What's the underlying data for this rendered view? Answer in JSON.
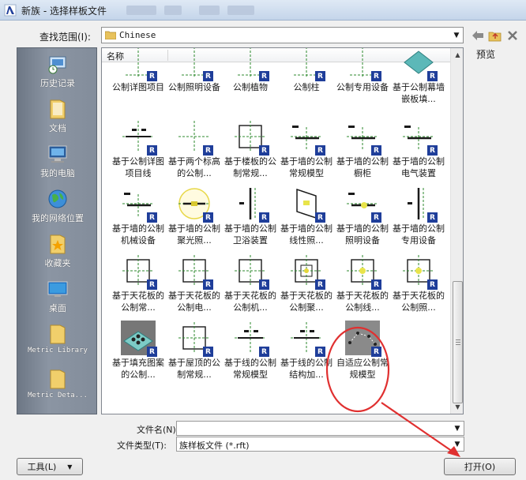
{
  "window": {
    "title": "新族 - 选择样板文件"
  },
  "look_in": {
    "label": "查找范围(I):",
    "value": "Chinese"
  },
  "places": [
    {
      "label": "历史记录",
      "icon": "history-icon"
    },
    {
      "label": "文档",
      "icon": "folder-icon"
    },
    {
      "label": "我的电脑",
      "icon": "computer-icon"
    },
    {
      "label": "我的网络位置",
      "icon": "network-globe-icon"
    },
    {
      "label": "收藏夹",
      "icon": "favorites-folder-icon"
    },
    {
      "label": "桌面",
      "icon": "desktop-icon"
    },
    {
      "label": "Metric Library",
      "icon": "folder-icon"
    },
    {
      "label": "Metric Deta...",
      "icon": "folder-icon"
    }
  ],
  "list": {
    "column_name": "名称",
    "rows": [
      [
        {
          "label": "公制详图项目",
          "icon": "dash-line-template-icon"
        },
        {
          "label": "公制照明设备",
          "icon": "dash-line-template-icon"
        },
        {
          "label": "公制植物",
          "icon": "dash-line-template-icon"
        },
        {
          "label": "公制柱",
          "icon": "dash-line-template-icon"
        },
        {
          "label": "公制专用设备",
          "icon": "dash-line-template-icon"
        },
        {
          "label": "基于公制幕墙嵌板填...",
          "icon": "panel-3d-icon"
        }
      ],
      [
        {
          "label": "基于公制详图项目线",
          "icon": "cross-line-template-icon"
        },
        {
          "label": "基于两个标高的公制...",
          "icon": "cross-template-icon"
        },
        {
          "label": "基于楼板的公制常规...",
          "icon": "box-cross-template-icon"
        },
        {
          "label": "基于墙的公制常规模型",
          "icon": "wall-line-template-icon"
        },
        {
          "label": "基于墙的公制橱柜",
          "icon": "wall-line-template-icon"
        },
        {
          "label": "基于墙的公制电气装置",
          "icon": "wall-line-template-icon"
        }
      ],
      [
        {
          "label": "基于墙的公制机械设备",
          "icon": "wall-line-template-icon"
        },
        {
          "label": "基于墙的公制聚光照...",
          "icon": "spotlight-template-icon"
        },
        {
          "label": "基于墙的公制卫浴装置",
          "icon": "vertical-line-template-icon"
        },
        {
          "label": "基于墙的公制线性照...",
          "icon": "linear-light-template-icon"
        },
        {
          "label": "基于墙的公制照明设备",
          "icon": "wall-light-template-icon"
        },
        {
          "label": "基于墙的公制专用设备",
          "icon": "vertical-line-template-icon"
        }
      ],
      [
        {
          "label": "基于天花板的公制常...",
          "icon": "box-cross-template-icon"
        },
        {
          "label": "基于天花板的公制电...",
          "icon": "box-cross-template-icon"
        },
        {
          "label": "基于天花板的公制机...",
          "icon": "box-cross-template-icon"
        },
        {
          "label": "基于天花板的公制聚...",
          "icon": "box-dot-template-icon"
        },
        {
          "label": "基于天花板的公制线...",
          "icon": "box-light-template-icon"
        },
        {
          "label": "基于天花板的公制照...",
          "icon": "box-light-template-icon"
        }
      ],
      [
        {
          "label": "基于填充图案的公制...",
          "icon": "pattern-3d-icon"
        },
        {
          "label": "基于屋顶的公制常规...",
          "icon": "box-cross-template-icon"
        },
        {
          "label": "基于线的公制常规模型",
          "icon": "cross-line-template-icon"
        },
        {
          "label": "基于线的公制结构加...",
          "icon": "cross-line-template-icon"
        },
        {
          "label": "自适应公制常规模型",
          "icon": "adaptive-3d-icon"
        }
      ]
    ]
  },
  "preview": {
    "label": "预览"
  },
  "file_name": {
    "label": "文件名(N):",
    "value": ""
  },
  "file_type": {
    "label": "文件类型(T):",
    "value": "族样板文件 (*.rft)"
  },
  "buttons": {
    "tools": "工具(L)",
    "open": "打开(O)"
  },
  "colors": {
    "annotation": "#e03030",
    "revit_badge": "#1f3e9a",
    "places_bar": "#7d8795"
  }
}
